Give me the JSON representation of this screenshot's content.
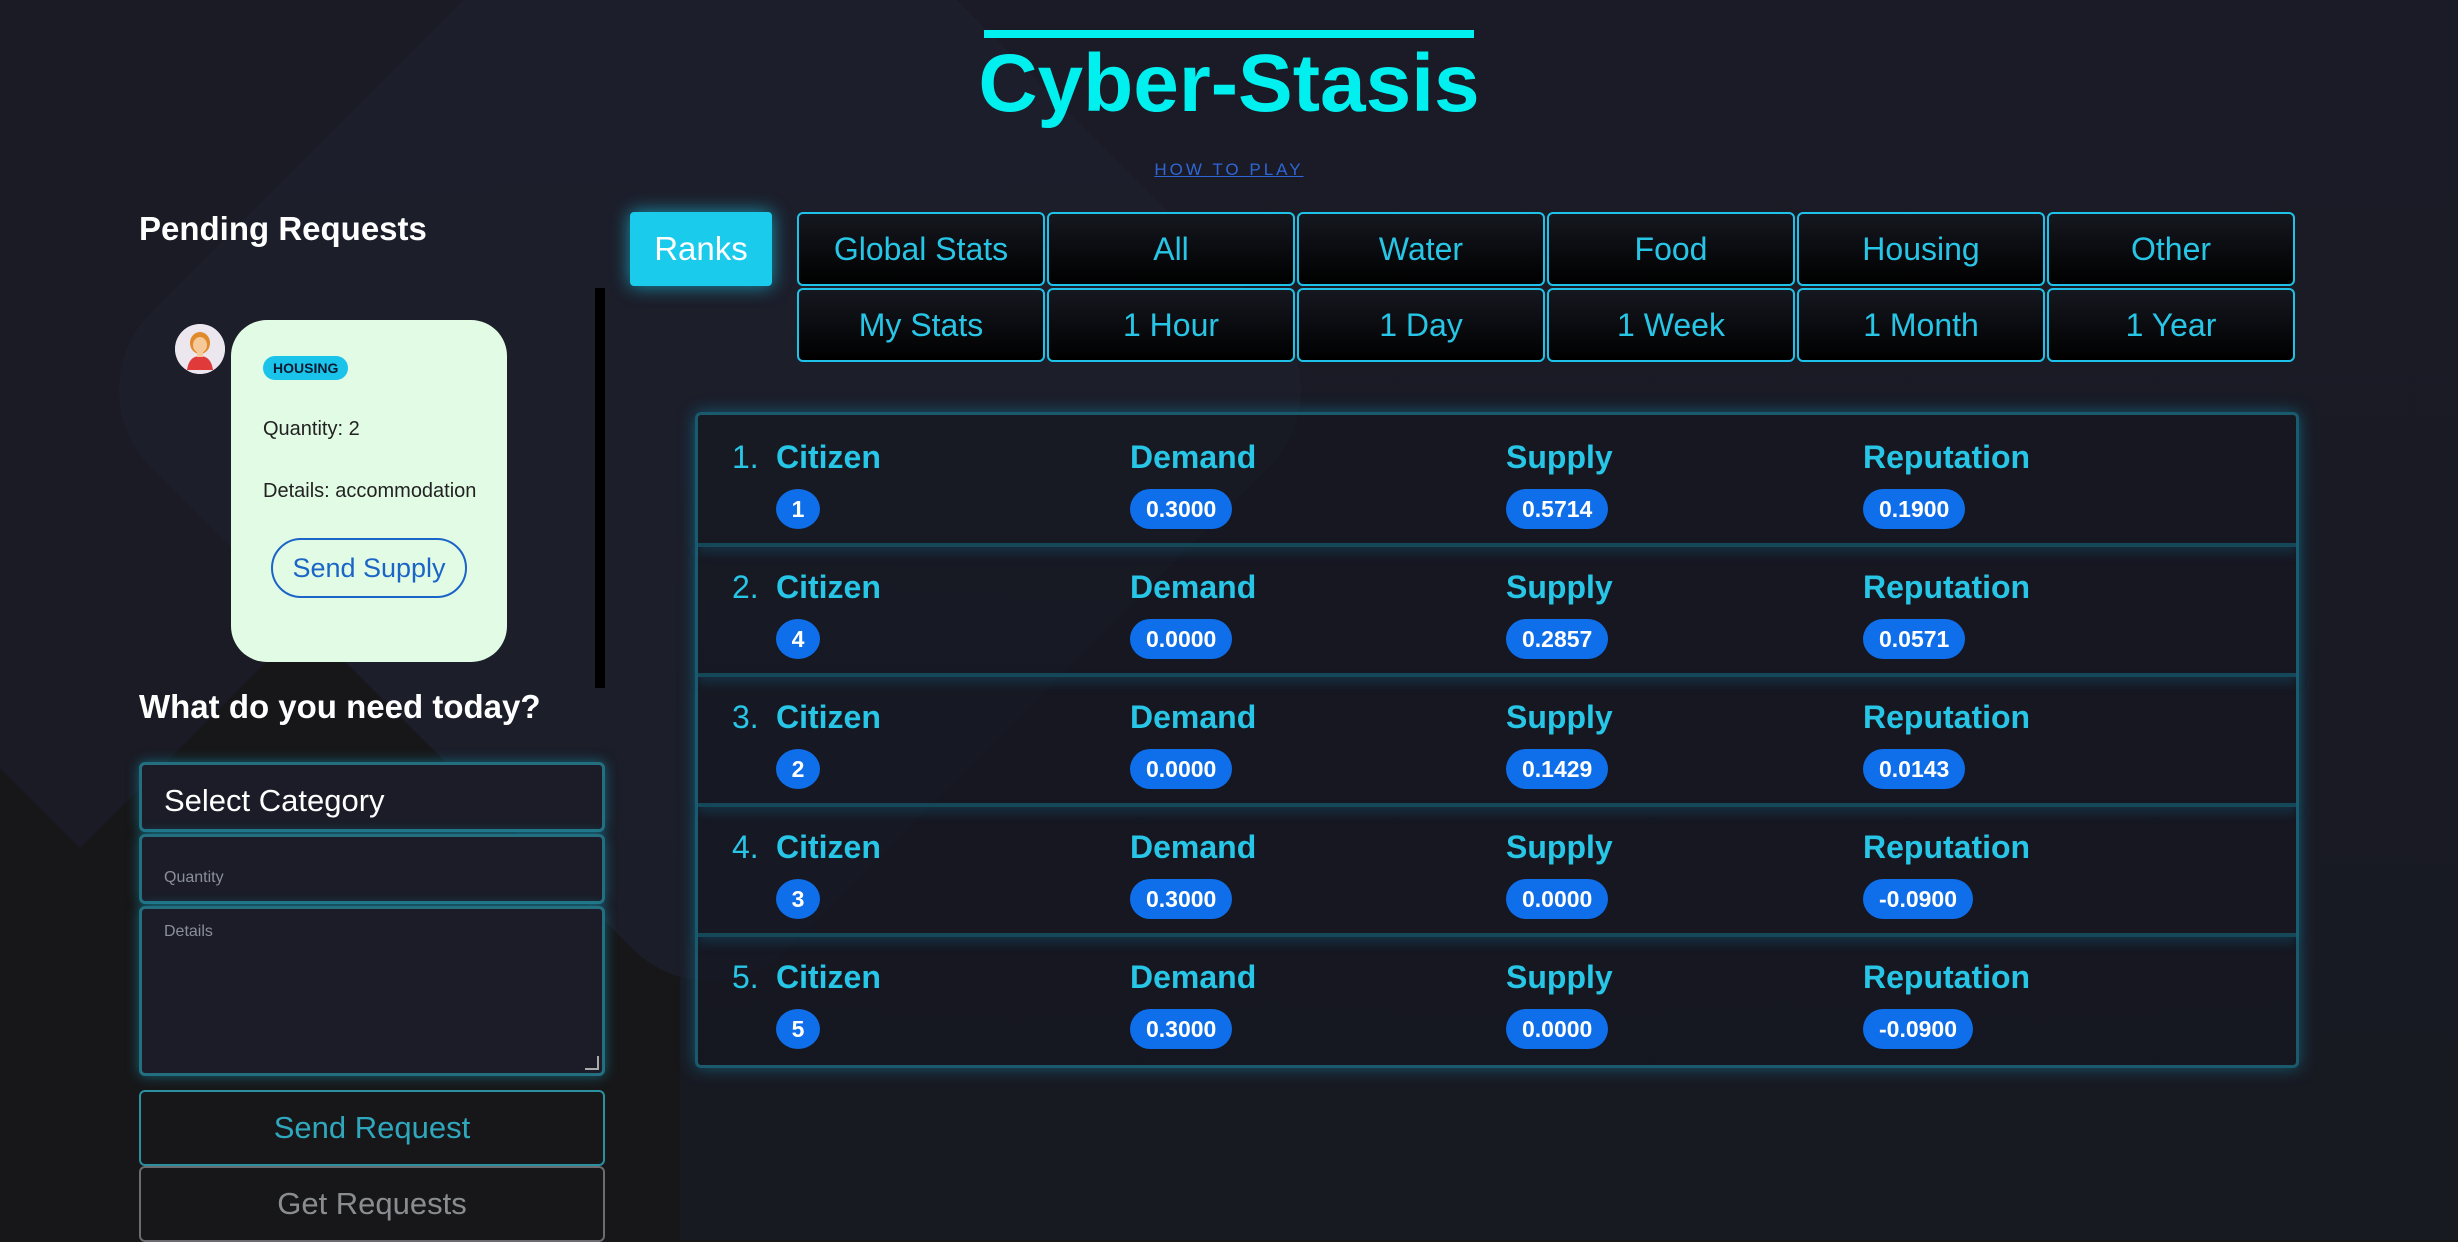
{
  "app": {
    "title": "Cyber-Stasis",
    "how_to_play": "HOW TO PLAY"
  },
  "sidebar": {
    "pending_title": "Pending Requests",
    "requests": [
      {
        "avatar_icon": "woman-avatar-icon",
        "category": "HOUSING",
        "quantity_text": "Quantity: 2",
        "details_text": "Details: accommodation",
        "action_label": "Send Supply"
      }
    ],
    "need_title": "What do you need today?",
    "select_category": "Select Category",
    "quantity_placeholder": "Quantity",
    "details_placeholder": "Details",
    "send_request_label": "Send Request",
    "get_requests_label": "Get Requests"
  },
  "tabs": {
    "ranks_label": "Ranks",
    "row1": [
      "Global Stats",
      "All",
      "Water",
      "Food",
      "Housing",
      "Other"
    ],
    "row2": [
      "My Stats",
      "1 Hour",
      "1 Day",
      "1 Week",
      "1 Month",
      "1 Year"
    ]
  },
  "leaderboard": {
    "columns": {
      "citizen": "Citizen",
      "demand": "Demand",
      "supply": "Supply",
      "reputation": "Reputation"
    },
    "rows": [
      {
        "rank": "1.",
        "citizen": "1",
        "demand": "0.3000",
        "supply": "0.5714",
        "reputation": "0.1900"
      },
      {
        "rank": "2.",
        "citizen": "4",
        "demand": "0.0000",
        "supply": "0.2857",
        "reputation": "0.0571"
      },
      {
        "rank": "3.",
        "citizen": "2",
        "demand": "0.0000",
        "supply": "0.1429",
        "reputation": "0.0143"
      },
      {
        "rank": "4.",
        "citizen": "3",
        "demand": "0.3000",
        "supply": "0.0000",
        "reputation": "-0.0900"
      },
      {
        "rank": "5.",
        "citizen": "5",
        "demand": "0.3000",
        "supply": "0.0000",
        "reputation": "-0.0900"
      }
    ]
  },
  "colors": {
    "accent": "#00f0f0",
    "tab_text": "#28c6e6",
    "pill": "#0f6ee9",
    "card_bg": "#e2fbe4"
  }
}
